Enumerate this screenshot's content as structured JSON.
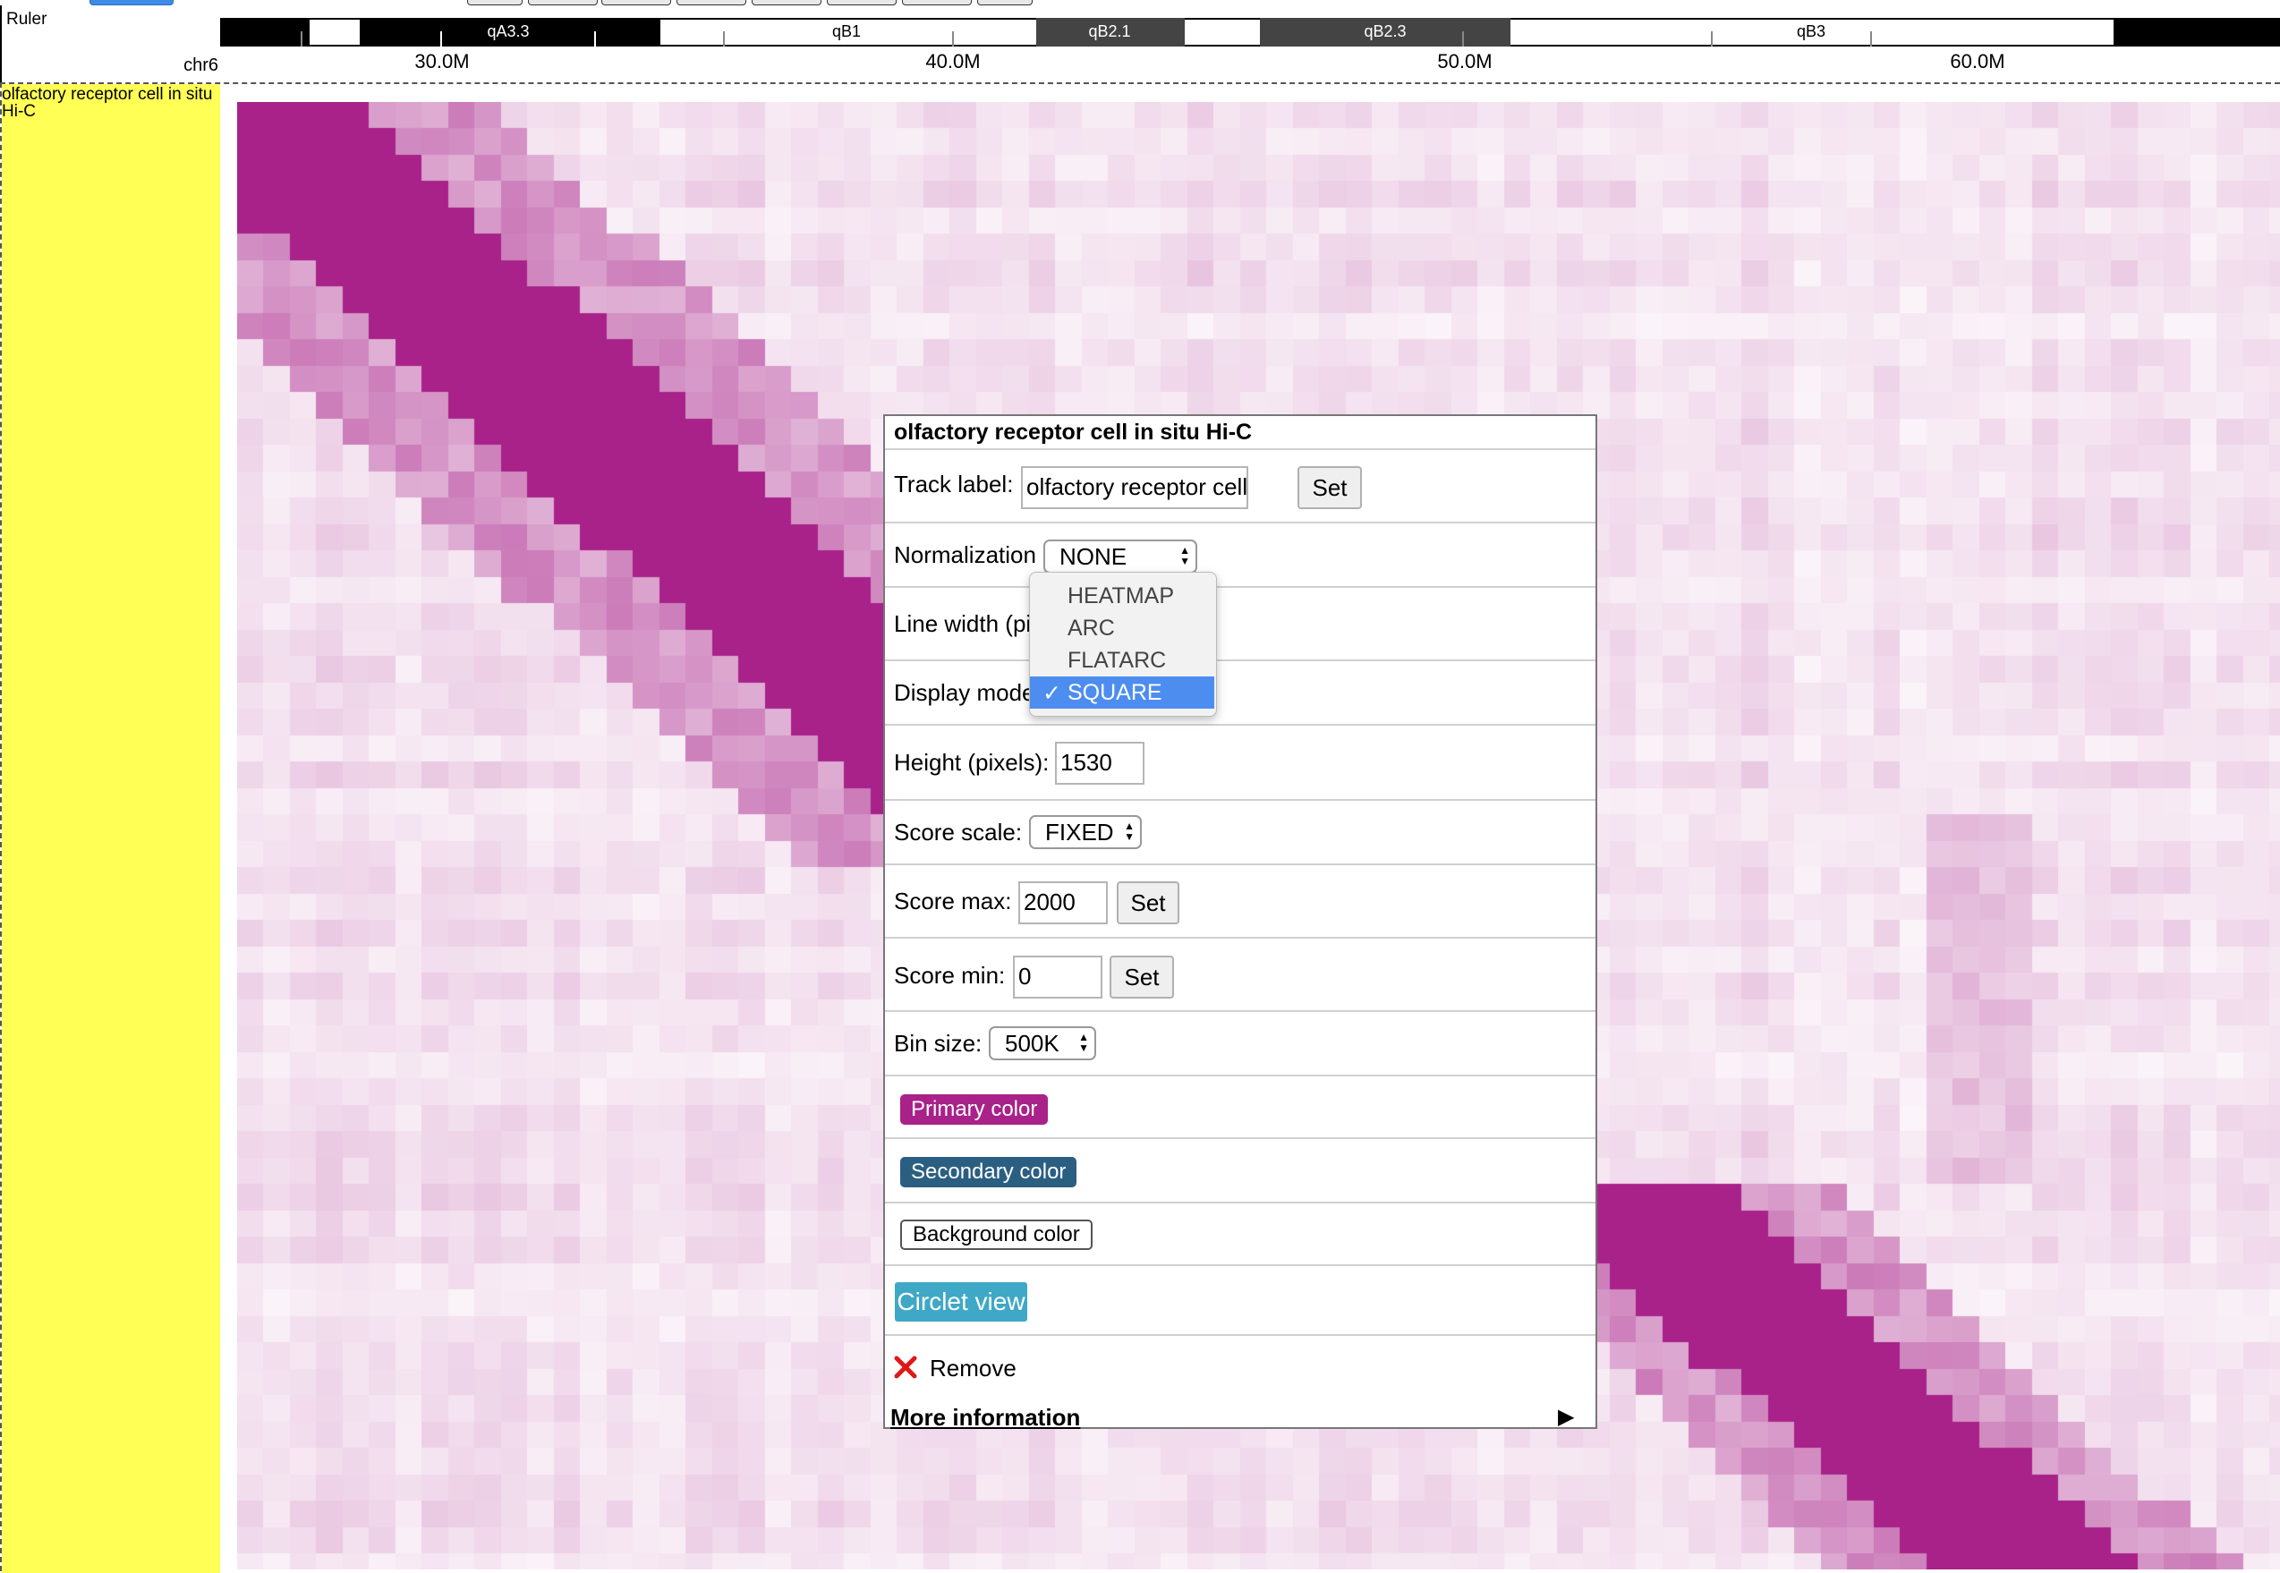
{
  "ruler": {
    "track_name": "Ruler",
    "chromosome": "chr6",
    "bands": [
      {
        "label": "qA3.3",
        "stain": "black"
      },
      {
        "label": "qB1",
        "stain": "white"
      },
      {
        "label": "qB2.1",
        "stain": "darkgray"
      },
      {
        "label": "qB2.3",
        "stain": "darkgray"
      },
      {
        "label": "qB3",
        "stain": "white"
      }
    ],
    "coordinates": [
      "30.0M",
      "40.0M",
      "50.0M",
      "60.0M"
    ]
  },
  "track": {
    "label": "olfactory receptor cell in situ Hi-C",
    "label_background": "#ffff55",
    "heatmap_color": "#a82289"
  },
  "menu": {
    "title": "olfactory receptor cell in situ Hi-C",
    "track_label_text": "Track label:",
    "track_label_value": "olfactory receptor cell in s",
    "set_label": "Set",
    "normalization_label": "Normalization",
    "normalization_value": "NONE",
    "line_width_label": "Line width (pi",
    "display_mode_label": "Display mode",
    "height_label": "Height (pixels):",
    "height_value": "1530",
    "score_scale_label": "Score scale:",
    "score_scale_value": "FIXED",
    "score_max_label": "Score max:",
    "score_max_value": "2000",
    "score_min_label": "Score min:",
    "score_min_value": "0",
    "bin_size_label": "Bin size:",
    "bin_size_value": "500K",
    "primary_color_label": "Primary color",
    "primary_color": "#a82289",
    "secondary_color_label": "Secondary color",
    "secondary_color": "#2b5f82",
    "background_color_label": "Background color",
    "circlet_label": "Circlet view",
    "circlet_color": "#3fa8c6",
    "remove_label": "Remove",
    "more_info_label": "More information",
    "more_info_arrow": "▶"
  },
  "dropdown": {
    "options": [
      "HEATMAP",
      "ARC",
      "FLATARC",
      "SQUARE"
    ],
    "selected": "SQUARE",
    "check": "✓"
  }
}
